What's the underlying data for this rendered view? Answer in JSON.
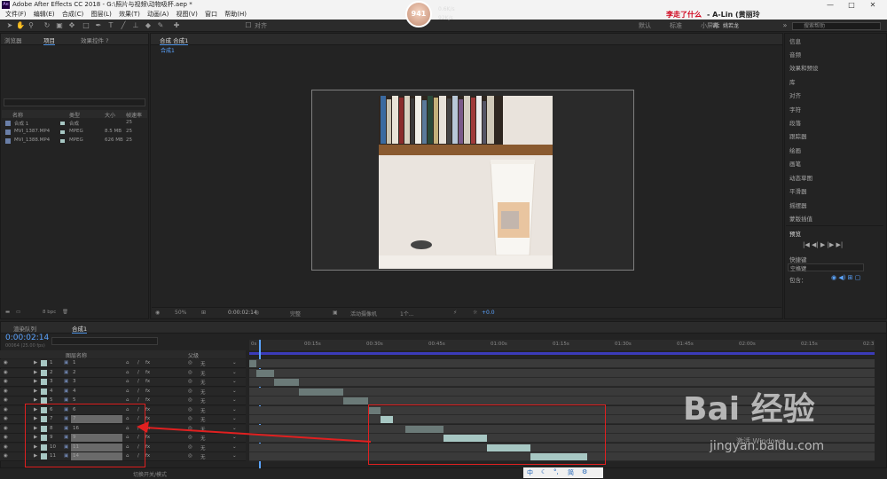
{
  "window": {
    "title": "Adobe After Effects CC 2018 - G:\\照片与视频\\动物吸杯.aep *",
    "logo": "Ae",
    "controls": [
      "—",
      "□",
      "✕"
    ]
  },
  "menu": [
    "文件(F)",
    "编辑(E)",
    "合成(C)",
    "图层(L)",
    "效果(T)",
    "动画(A)",
    "视图(V)",
    "窗口",
    "帮助(H)"
  ],
  "overlay": {
    "title_red": "李走了什么",
    "title_rest": " - A-Lin (黄丽玲",
    "subtitle": "词：姚若龙",
    "avatar": "941",
    "stat1": "0.6K/s",
    "stat2": "92K/s"
  },
  "toolbar": {
    "workspaces": [
      "默认",
      "标准",
      "小屏幕"
    ],
    "search_placeholder": "搜索帮助",
    "align_label": "对齐"
  },
  "project_panel": {
    "tabs": [
      "效果控件 ?",
      "项目",
      "效果控件 ?"
    ],
    "tab_left": "浏览器",
    "columns": [
      "名称",
      "类型",
      "大小",
      "帧速率"
    ],
    "rows": [
      {
        "name": "合成 1",
        "type": "合成",
        "size": "",
        "fps": "25",
        "color": "#a7c7c3"
      },
      {
        "name": "MVI_1387.MP4",
        "type": "MPEG",
        "size": "8.5 MB",
        "fps": "25",
        "color": "#a7c7c3"
      },
      {
        "name": "MVI_1388.MP4",
        "type": "MPEG",
        "size": "626 MB",
        "fps": "25",
        "color": "#a7c7c3"
      }
    ],
    "bpc": "8 bpc"
  },
  "comp_viewer": {
    "tab": "合成 合成1",
    "breadcrumb": "合成1",
    "zoom": "50%",
    "timecode": "0:00:02:14",
    "resolution": "完整",
    "camera": "活动摄像机",
    "views": "1个...",
    "exposure": "+0.0"
  },
  "right_panel": {
    "items": [
      "信息",
      "音频",
      "效果和预设",
      "库",
      "对齐",
      "字符",
      "段落",
      "跟踪器",
      "绘画",
      "画笔",
      "动态草图",
      "平滑器",
      "摇摆器",
      "蒙版插值"
    ],
    "preview": "预览",
    "shortcut_label": "快捷键",
    "shortcut_value": "空格键",
    "include_label": "包含："
  },
  "timeline": {
    "tabs": [
      "渲染队列",
      "合成1"
    ],
    "timecode": "0:00:02:14",
    "fps_info": "00064 (25.00 fps)",
    "columns": [
      "图层名称",
      "父级"
    ],
    "ruler_ticks": [
      "0s",
      "00:15s",
      "00:30s",
      "00:45s",
      "01:00s",
      "01:15s",
      "01:30s",
      "01:45s",
      "02:00s",
      "02:15s",
      "02:3"
    ],
    "layers": [
      {
        "num": "1",
        "name": "1",
        "parent": "无",
        "bar_start": 0.0,
        "bar_end": 0.012,
        "sel": false
      },
      {
        "num": "2",
        "name": "2",
        "parent": "无",
        "bar_start": 0.012,
        "bar_end": 0.04,
        "sel": false
      },
      {
        "num": "3",
        "name": "3",
        "parent": "无",
        "bar_start": 0.04,
        "bar_end": 0.08,
        "sel": false
      },
      {
        "num": "4",
        "name": "4",
        "parent": "无",
        "bar_start": 0.08,
        "bar_end": 0.15,
        "sel": false
      },
      {
        "num": "5",
        "name": "5",
        "parent": "无",
        "bar_start": 0.15,
        "bar_end": 0.19,
        "sel": false
      },
      {
        "num": "6",
        "name": "6",
        "parent": "无",
        "bar_start": 0.19,
        "bar_end": 0.21,
        "sel": false
      },
      {
        "num": "7",
        "name": "7",
        "parent": "无",
        "bar_start": 0.21,
        "bar_end": 0.23,
        "sel": true
      },
      {
        "num": "8",
        "name": "16",
        "parent": "无",
        "bar_start": 0.25,
        "bar_end": 0.31,
        "sel": false
      },
      {
        "num": "9",
        "name": "9",
        "parent": "无",
        "bar_start": 0.31,
        "bar_end": 0.38,
        "sel": true
      },
      {
        "num": "10",
        "name": "11",
        "parent": "无",
        "bar_start": 0.38,
        "bar_end": 0.45,
        "sel": true
      },
      {
        "num": "11",
        "name": "14",
        "parent": "无",
        "bar_start": 0.45,
        "bar_end": 0.54,
        "sel": true
      }
    ],
    "footer": "切换开关/模式"
  },
  "watermark": {
    "logo": "Bai 经验",
    "url": "jingyan.baidu.com",
    "win": "激活 Windows"
  },
  "tray": [
    "中",
    "☾",
    "°,",
    "简",
    "⚙"
  ]
}
